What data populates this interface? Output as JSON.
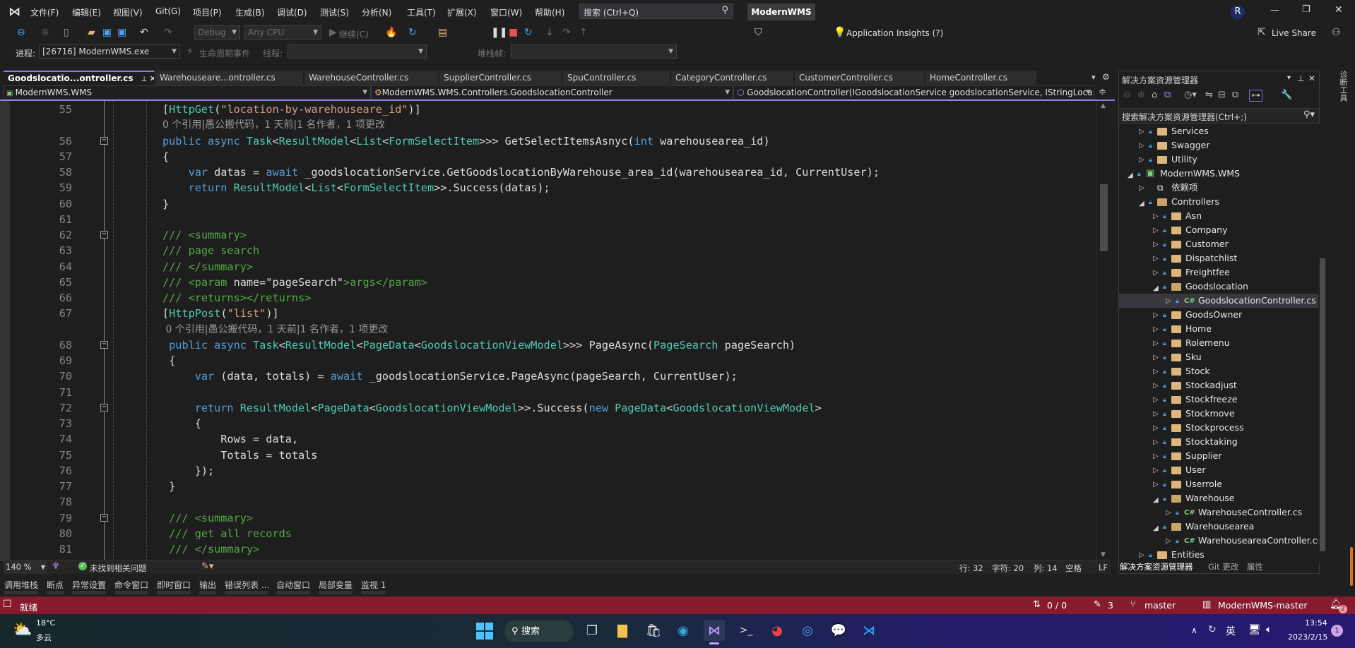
{
  "title_bar": {
    "menu": [
      "文件(F)",
      "编辑(E)",
      "视图(V)",
      "Git(G)",
      "项目(P)",
      "生成(B)",
      "调试(D)",
      "测试(S)",
      "分析(N)",
      "工具(T)",
      "扩展(X)",
      "窗口(W)",
      "帮助(H)"
    ],
    "search_placeholder": "搜索 (Ctrl+Q)",
    "solution_name": "ModernWMS",
    "avatar_initial": "R"
  },
  "toolbar": {
    "config": "Debug",
    "platform": "Any CPU",
    "continue_label": "继续(C)",
    "app_insights": "Application Insights (?)",
    "live_share": "Live Share",
    "process_label": "进程:",
    "process_value": "[26716] ModernWMS.exe",
    "lifecycle_label": "生命周期事件",
    "thread_label": "线程:",
    "thread_value": "",
    "stackframe_label": "堆栈帧:",
    "stackframe_value": ""
  },
  "tabs": [
    {
      "label": "Goodslocatio...ontroller.cs",
      "active": true
    },
    {
      "label": "Warehouseare...ontroller.cs"
    },
    {
      "label": "WarehouseController.cs"
    },
    {
      "label": "SupplierController.cs"
    },
    {
      "label": "SpuController.cs"
    },
    {
      "label": "CategoryController.cs"
    },
    {
      "label": "CustomerController.cs"
    },
    {
      "label": "HomeController.cs"
    }
  ],
  "navbar": {
    "project": "ModernWMS.WMS",
    "class": "ModernWMS.WMS.Controllers.GoodslocationController",
    "member": "GoodslocationController(IGoodslocationService goodslocationService, IStringLoca"
  },
  "code": {
    "rows": [
      {
        "n": "55",
        "segs": [
          [
            "tx",
            "["
          ],
          [
            "ty",
            "HttpGet"
          ],
          [
            "tx",
            "("
          ],
          [
            "str",
            "\"location-by-warehouseare_id\""
          ],
          [
            "tx",
            ")]"
          ]
        ]
      },
      {
        "lens": "0 个引用|愚公搬代码，1 天前|1 名作者，1 项更改"
      },
      {
        "n": "56",
        "fold": true,
        "segs": [
          [
            "kw",
            "public async "
          ],
          [
            "ty",
            "Task"
          ],
          [
            "tx",
            "<"
          ],
          [
            "ty",
            "ResultModel"
          ],
          [
            "tx",
            "<"
          ],
          [
            "ty",
            "List"
          ],
          [
            "tx",
            "<"
          ],
          [
            "ty",
            "FormSelectItem"
          ],
          [
            "tx",
            ">>> GetSelectItemsAsnyc("
          ],
          [
            "kw",
            "int"
          ],
          [
            "tx",
            " warehousearea_id)"
          ]
        ]
      },
      {
        "n": "57",
        "segs": [
          [
            "tx",
            "{"
          ]
        ]
      },
      {
        "n": "58",
        "segs": [
          [
            "tx",
            "    "
          ],
          [
            "kw",
            "var"
          ],
          [
            "tx",
            " datas = "
          ],
          [
            "kw",
            "await"
          ],
          [
            "tx",
            " _goodslocationService.GetGoodslocationByWarehouse_area_id(warehousearea_id, CurrentUser);"
          ]
        ]
      },
      {
        "n": "59",
        "segs": [
          [
            "tx",
            "    "
          ],
          [
            "kw",
            "return "
          ],
          [
            "ty",
            "ResultModel"
          ],
          [
            "tx",
            "<"
          ],
          [
            "ty",
            "List"
          ],
          [
            "tx",
            "<"
          ],
          [
            "ty",
            "FormSelectItem"
          ],
          [
            "tx",
            ">>.Success(datas);"
          ]
        ]
      },
      {
        "n": "60",
        "segs": [
          [
            "tx",
            "}"
          ]
        ]
      },
      {
        "n": "61",
        "segs": []
      },
      {
        "n": "62",
        "fold": true,
        "segs": [
          [
            "cm",
            "/// <summary>"
          ]
        ]
      },
      {
        "n": "63",
        "segs": [
          [
            "cm",
            "/// page search"
          ]
        ]
      },
      {
        "n": "64",
        "segs": [
          [
            "cm",
            "/// </summary>"
          ]
        ]
      },
      {
        "n": "65",
        "segs": [
          [
            "cm",
            "/// <param "
          ],
          [
            "tx",
            "name=\"pageSearch\""
          ],
          [
            "cm",
            ">args</param>"
          ]
        ]
      },
      {
        "n": "66",
        "segs": [
          [
            "cm",
            "/// <returns></returns>"
          ]
        ]
      },
      {
        "n": "67",
        "segs": [
          [
            "tx",
            "["
          ],
          [
            "ty",
            "HttpPost"
          ],
          [
            "tx",
            "("
          ],
          [
            "str",
            "\"list\""
          ],
          [
            "tx",
            ")]"
          ]
        ]
      },
      {
        "lens": " 0 个引用|愚公搬代码，1 天前|1 名作者，1 项更改"
      },
      {
        "n": "68",
        "fold": true,
        "segs": [
          [
            "tx",
            " "
          ],
          [
            "kw",
            "public async "
          ],
          [
            "ty",
            "Task"
          ],
          [
            "tx",
            "<"
          ],
          [
            "ty",
            "ResultModel"
          ],
          [
            "tx",
            "<"
          ],
          [
            "ty",
            "PageData"
          ],
          [
            "tx",
            "<"
          ],
          [
            "ty",
            "GoodslocationViewModel"
          ],
          [
            "tx",
            ">>> PageAsync("
          ],
          [
            "ty",
            "PageSearch"
          ],
          [
            "tx",
            " pageSearch)"
          ]
        ]
      },
      {
        "n": "69",
        "segs": [
          [
            "tx",
            " {"
          ]
        ]
      },
      {
        "n": "70",
        "segs": [
          [
            "tx",
            "     "
          ],
          [
            "kw",
            "var"
          ],
          [
            "tx",
            " (data, totals) = "
          ],
          [
            "kw",
            "await"
          ],
          [
            "tx",
            " _goodslocationService.PageAsync(pageSearch, CurrentUser);"
          ]
        ]
      },
      {
        "n": "71",
        "segs": []
      },
      {
        "n": "72",
        "fold": true,
        "segs": [
          [
            "tx",
            "     "
          ],
          [
            "kw",
            "return "
          ],
          [
            "ty",
            "ResultModel"
          ],
          [
            "tx",
            "<"
          ],
          [
            "ty",
            "PageData"
          ],
          [
            "tx",
            "<"
          ],
          [
            "ty",
            "GoodslocationViewModel"
          ],
          [
            "tx",
            ">>.Success("
          ],
          [
            "kw",
            "new "
          ],
          [
            "ty",
            "PageData"
          ],
          [
            "tx",
            "<"
          ],
          [
            "ty",
            "GoodslocationViewModel"
          ],
          [
            "tx",
            ">"
          ]
        ]
      },
      {
        "n": "73",
        "segs": [
          [
            "tx",
            "     {"
          ]
        ]
      },
      {
        "n": "74",
        "segs": [
          [
            "tx",
            "         Rows = data,"
          ]
        ]
      },
      {
        "n": "75",
        "segs": [
          [
            "tx",
            "         Totals = totals"
          ]
        ]
      },
      {
        "n": "76",
        "segs": [
          [
            "tx",
            "     });"
          ]
        ]
      },
      {
        "n": "77",
        "segs": [
          [
            "tx",
            " }"
          ]
        ]
      },
      {
        "n": "78",
        "segs": []
      },
      {
        "n": "79",
        "fold": true,
        "segs": [
          [
            "cm",
            " /// <summary>"
          ]
        ]
      },
      {
        "n": "80",
        "segs": [
          [
            "cm",
            " /// get all records"
          ]
        ]
      },
      {
        "n": "81",
        "segs": [
          [
            "cm",
            " /// </summary>"
          ]
        ]
      }
    ]
  },
  "editor_status": {
    "zoom": "140 %",
    "issues": "未找到相关问题",
    "line": "行: 32",
    "char": "字符: 20",
    "col": "列: 14",
    "whitespace": "空格",
    "eol": "LF"
  },
  "solution_explorer": {
    "title": "解决方案资源管理器",
    "search_placeholder": "搜索解决方案资源管理器(Ctrl+;)",
    "items": [
      {
        "label": "Services",
        "level": 1,
        "exp": "closed",
        "icon": "folder"
      },
      {
        "label": "Swagger",
        "level": 1,
        "exp": "closed",
        "icon": "folder"
      },
      {
        "label": "Utility",
        "level": 1,
        "exp": "closed",
        "icon": "folder"
      },
      {
        "label": "ModernWMS.WMS",
        "level": 0,
        "exp": "open",
        "icon": "csproj"
      },
      {
        "label": "依赖项",
        "level": 1,
        "exp": "closed",
        "icon": "dependencies"
      },
      {
        "label": "Controllers",
        "level": 1,
        "exp": "open",
        "icon": "folder"
      },
      {
        "label": "Asn",
        "level": 2,
        "exp": "closed",
        "icon": "folder"
      },
      {
        "label": "Company",
        "level": 2,
        "exp": "closed",
        "icon": "folder"
      },
      {
        "label": "Customer",
        "level": 2,
        "exp": "closed",
        "icon": "folder"
      },
      {
        "label": "Dispatchlist",
        "level": 2,
        "exp": "closed",
        "icon": "folder"
      },
      {
        "label": "Freightfee",
        "level": 2,
        "exp": "closed",
        "icon": "folder"
      },
      {
        "label": "Goodslocation",
        "level": 2,
        "exp": "open",
        "icon": "folder"
      },
      {
        "label": "GoodslocationController.cs",
        "level": 3,
        "exp": "closed",
        "icon": "csharp",
        "selected": true
      },
      {
        "label": "GoodsOwner",
        "level": 2,
        "exp": "closed",
        "icon": "folder"
      },
      {
        "label": "Home",
        "level": 2,
        "exp": "closed",
        "icon": "folder"
      },
      {
        "label": "Rolemenu",
        "level": 2,
        "exp": "closed",
        "icon": "folder"
      },
      {
        "label": "Sku",
        "level": 2,
        "exp": "closed",
        "icon": "folder"
      },
      {
        "label": "Stock",
        "level": 2,
        "exp": "closed",
        "icon": "folder"
      },
      {
        "label": "Stockadjust",
        "level": 2,
        "exp": "closed",
        "icon": "folder"
      },
      {
        "label": "Stockfreeze",
        "level": 2,
        "exp": "closed",
        "icon": "folder"
      },
      {
        "label": "Stockmove",
        "level": 2,
        "exp": "closed",
        "icon": "folder"
      },
      {
        "label": "Stockprocess",
        "level": 2,
        "exp": "closed",
        "icon": "folder"
      },
      {
        "label": "Stocktaking",
        "level": 2,
        "exp": "closed",
        "icon": "folder"
      },
      {
        "label": "Supplier",
        "level": 2,
        "exp": "closed",
        "icon": "folder"
      },
      {
        "label": "User",
        "level": 2,
        "exp": "closed",
        "icon": "folder"
      },
      {
        "label": "Userrole",
        "level": 2,
        "exp": "closed",
        "icon": "folder"
      },
      {
        "label": "Warehouse",
        "level": 2,
        "exp": "open",
        "icon": "folder"
      },
      {
        "label": "WarehouseController.cs",
        "level": 3,
        "exp": "closed",
        "icon": "csharp"
      },
      {
        "label": "Warehousearea",
        "level": 2,
        "exp": "open",
        "icon": "folder"
      },
      {
        "label": "WarehouseareaController.cs",
        "level": 3,
        "exp": "closed",
        "icon": "csharp"
      },
      {
        "label": "Entities",
        "level": 1,
        "exp": "closed",
        "icon": "folder"
      }
    ],
    "bottom_tabs": [
      "解决方案资源管理器",
      "Git 更改",
      "属性"
    ]
  },
  "side_strip": "诊断工具",
  "bottom_tools": [
    "调用堆栈",
    "断点",
    "异常设置",
    "命令窗口",
    "即时窗口",
    "输出",
    "错误列表 ...",
    "自动窗口",
    "局部变量",
    "监视 1"
  ],
  "status_bar": {
    "ready": "就绪",
    "sync": "0 / 0",
    "changes": "3",
    "branch": "master",
    "repo": "ModernWMS-master",
    "notifications": "2",
    "color": "#861b2d"
  },
  "taskbar": {
    "weather_temp": "18°C",
    "weather_desc": "多云",
    "search_label": "搜索",
    "ime": "英",
    "time": "13:54",
    "date": "2023/2/15",
    "notification_count": "1"
  }
}
